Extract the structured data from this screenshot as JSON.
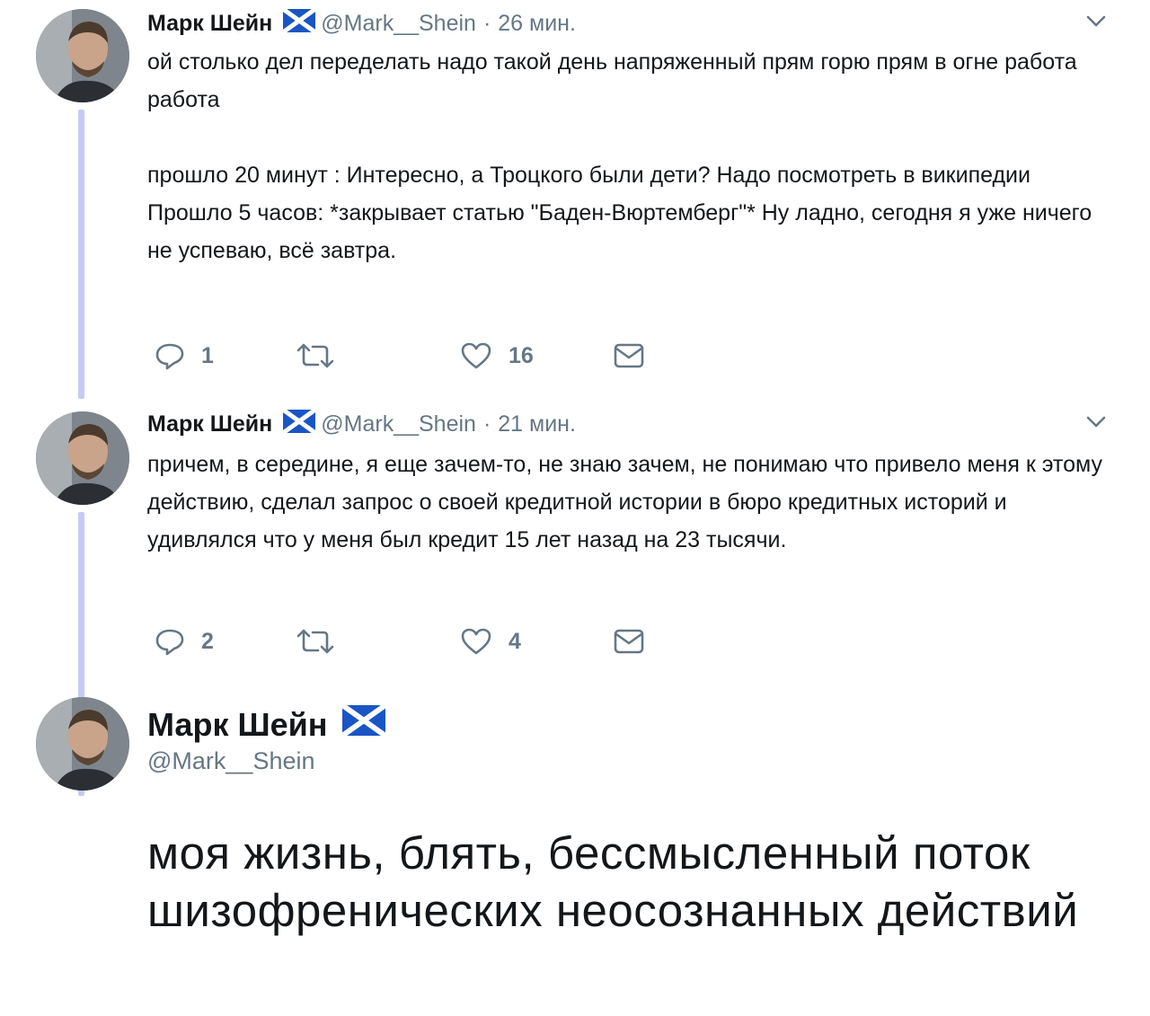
{
  "colors": {
    "text": "#14171a",
    "secondary": "#657786",
    "thread_line": "#c4cbf6",
    "flag_blue": "#1a55c4"
  },
  "tweets": [
    {
      "name": "Марк Шейн",
      "flag_icon": "scottish-flag-icon",
      "handle": "@Mark__Shein",
      "separator": "·",
      "time": "26 мин.",
      "text_lines": [
        "ой столько дел переделать надо такой день напряженный прям горю прям в огне работа работа",
        "прошло 20 минут : Интересно, а Троцкого были дети? Надо посмотреть в википедии\nПрошло 5 часов: *закрывает статью \"Баден-Вюртемберг\"* Ну ладно, сегодня я уже ничего не успеваю, всё завтра."
      ],
      "replies": "1",
      "likes": "16"
    },
    {
      "name": "Марк Шейн",
      "flag_icon": "scottish-flag-icon",
      "handle": "@Mark__Shein",
      "separator": "·",
      "time": "21 мин.",
      "text": "причем, в середине, я еще зачем-то, не знаю зачем, не понимаю что привело меня к этому действию, сделал запрос о своей кредитной истории в бюро кредитных историй и удивлялся что у меня был кредит 15 лет назад на 23 тысячи.",
      "replies": "2",
      "likes": "4"
    }
  ],
  "main_tweet": {
    "name": "Марк Шейн",
    "flag_icon": "scottish-flag-icon",
    "handle": "@Mark__Shein",
    "text": "моя жизнь, блять, бессмысленный поток шизофренических неосознанных действий"
  }
}
